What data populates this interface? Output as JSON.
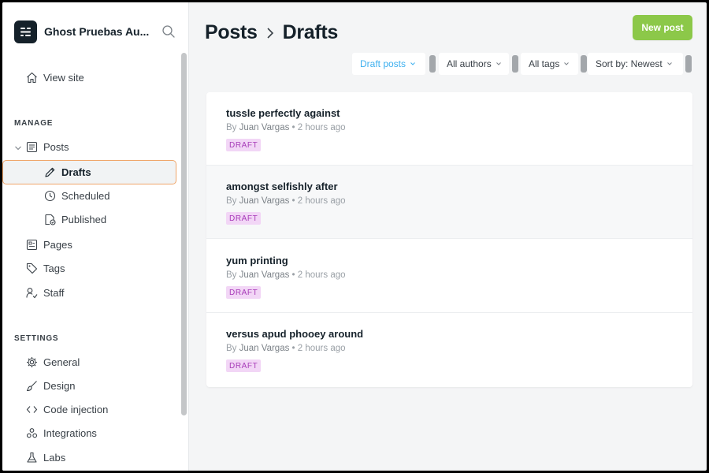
{
  "brand": {
    "title": "Ghost Pruebas Au...",
    "logo_icon": "ghost-logo-icon"
  },
  "sidebar": {
    "view_site": "View site",
    "manage_label": "MANAGE",
    "settings_label": "SETTINGS",
    "posts": "Posts",
    "drafts": "Drafts",
    "scheduled": "Scheduled",
    "published": "Published",
    "pages": "Pages",
    "tags": "Tags",
    "staff": "Staff",
    "general": "General",
    "design": "Design",
    "code_injection": "Code injection",
    "integrations": "Integrations",
    "labs": "Labs"
  },
  "header": {
    "section": "Posts",
    "current": "Drafts",
    "new_post": "New post"
  },
  "filters": {
    "type": "Draft posts",
    "authors": "All authors",
    "tags": "All tags",
    "sort": "Sort by: Newest"
  },
  "posts": [
    {
      "title": "tussle perfectly against",
      "by": "By",
      "author": "Juan Vargas",
      "sep": "•",
      "time": "2 hours ago",
      "status": "DRAFT"
    },
    {
      "title": "amongst selfishly after",
      "by": "By",
      "author": "Juan Vargas",
      "sep": "•",
      "time": "2 hours ago",
      "status": "DRAFT"
    },
    {
      "title": "yum printing",
      "by": "By",
      "author": "Juan Vargas",
      "sep": "•",
      "time": "2 hours ago",
      "status": "DRAFT"
    },
    {
      "title": "versus apud phooey around",
      "by": "By",
      "author": "Juan Vargas",
      "sep": "•",
      "time": "2 hours ago",
      "status": "DRAFT"
    }
  ],
  "colors": {
    "accent_green": "#8cc849",
    "filter_active_blue": "#3eb0ef",
    "badge_bg": "#f2d6f6",
    "badge_text": "#a73bb8",
    "active_border": "#f0a66a"
  }
}
